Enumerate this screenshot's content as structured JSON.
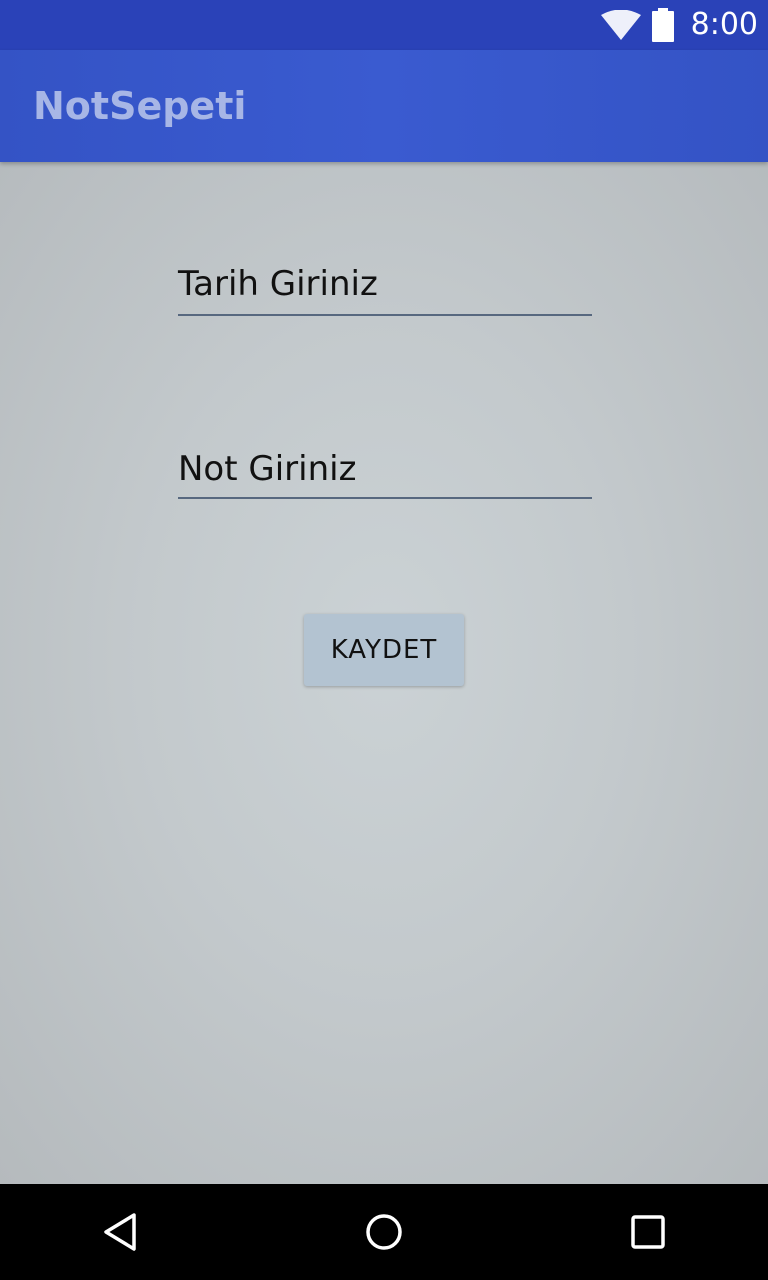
{
  "status_bar": {
    "time": "8:00",
    "icons": [
      "wifi-icon",
      "battery-icon"
    ]
  },
  "app_bar": {
    "title": "NotSepeti"
  },
  "form": {
    "date_field": {
      "value": "Tarih Giriniz"
    },
    "note_field": {
      "value": "Not Giriniz"
    },
    "save_button": {
      "label": "KAYDET"
    }
  },
  "nav_bar": {
    "icons": [
      "back-icon",
      "home-icon",
      "recents-icon"
    ]
  },
  "colors": {
    "status_bar": "#2a42b8",
    "app_bar": "#3a5bd0",
    "app_title": "#a7b6e6",
    "content_background": "#c3c9cc",
    "field_underline": "#57687f",
    "button_background": "#b3c3d1",
    "nav_bar": "#000000"
  }
}
